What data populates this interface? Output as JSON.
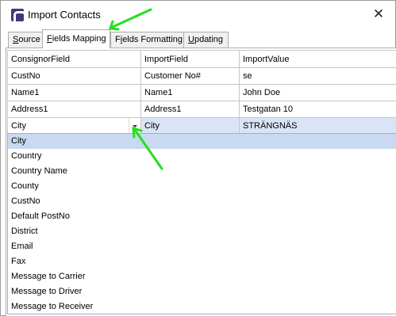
{
  "window": {
    "title": "Import Contacts",
    "close_glyph": "✕"
  },
  "tabs": [
    {
      "prefix": "",
      "mnemonic": "S",
      "rest": "ource",
      "active": false
    },
    {
      "prefix": "",
      "mnemonic": "F",
      "rest": "ields Mapping",
      "active": true
    },
    {
      "prefix": "F",
      "mnemonic": "i",
      "rest": "elds Formatting",
      "active": false
    },
    {
      "prefix": "",
      "mnemonic": "U",
      "rest": "pdating",
      "active": false
    }
  ],
  "grid": {
    "headers": [
      "ConsignorField",
      "ImportField",
      "ImportValue"
    ],
    "rows": [
      [
        "CustNo",
        "Customer No#",
        "se"
      ],
      [
        "Name1",
        "Name1",
        "John Doe"
      ],
      [
        "Address1",
        "Address1",
        "Testgatan 10"
      ],
      [
        "City",
        "City",
        "STRÄNGNÄS"
      ]
    ],
    "selected_row": 3
  },
  "dropdown": {
    "highlighted": "City",
    "items": [
      "City",
      "Country",
      "Country Name",
      "County",
      "CustNo",
      "Default PostNo",
      "District",
      "Email",
      "Fax",
      "Message to Carrier",
      "Message to Driver",
      "Message to Receiver"
    ]
  },
  "colors": {
    "annotation_arrow": "#22e01f",
    "selected_row": "#d9e5f6",
    "dropdown_highlight": "#c9d9f1"
  },
  "icons": {
    "app": "app-logo-icon",
    "close": "close-icon",
    "combo": "chevron-down-icon",
    "annotation": "arrow-annotation-icon"
  }
}
